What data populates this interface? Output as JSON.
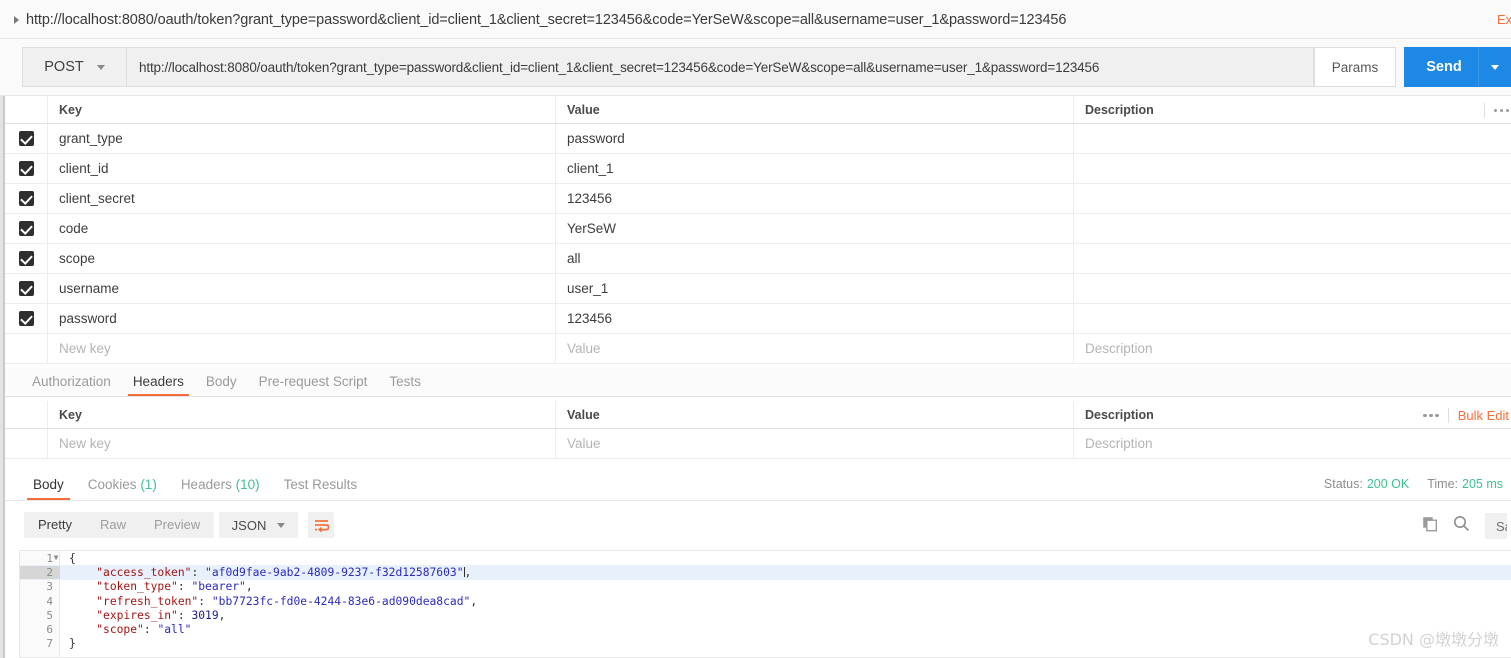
{
  "titlebar": {
    "url": "http://localhost:8080/oauth/token?grant_type=password&client_id=client_1&client_secret=123456&code=YerSeW&scope=all&username=user_1&password=123456",
    "examples_label": "Examples"
  },
  "request": {
    "method": "POST",
    "url_value": "http://localhost:8080/oauth/token?grant_type=password&client_id=client_1&client_secret=123456&code=YerSeW&scope=all&username=user_1&password=123456",
    "params_button": "Params",
    "send_button": "Send"
  },
  "params_table": {
    "headers": {
      "key": "Key",
      "value": "Value",
      "description": "Description"
    },
    "rows": [
      {
        "checked": true,
        "key": "grant_type",
        "value": "password",
        "description": ""
      },
      {
        "checked": true,
        "key": "client_id",
        "value": "client_1",
        "description": ""
      },
      {
        "checked": true,
        "key": "client_secret",
        "value": "123456",
        "description": ""
      },
      {
        "checked": true,
        "key": "code",
        "value": "YerSeW",
        "description": ""
      },
      {
        "checked": true,
        "key": "scope",
        "value": "all",
        "description": ""
      },
      {
        "checked": true,
        "key": "username",
        "value": "user_1",
        "description": ""
      },
      {
        "checked": true,
        "key": "password",
        "value": "123456",
        "description": ""
      }
    ],
    "new_row": {
      "key_placeholder": "New key",
      "value_placeholder": "Value",
      "description_placeholder": "Description"
    }
  },
  "request_tabs": [
    {
      "label": "Authorization",
      "active": false
    },
    {
      "label": "Headers",
      "active": true
    },
    {
      "label": "Body",
      "active": false
    },
    {
      "label": "Pre-request Script",
      "active": false
    },
    {
      "label": "Tests",
      "active": false
    }
  ],
  "headers_table": {
    "headers": {
      "key": "Key",
      "value": "Value",
      "description": "Description"
    },
    "bulk_edit_label": "Bulk Edit",
    "new_row": {
      "key_placeholder": "New key",
      "value_placeholder": "Value",
      "description_placeholder": "Description"
    }
  },
  "response": {
    "tabs": [
      {
        "label": "Body",
        "count": "",
        "active": true
      },
      {
        "label": "Cookies",
        "count": "(1)",
        "active": false
      },
      {
        "label": "Headers",
        "count": "(10)",
        "active": false
      },
      {
        "label": "Test Results",
        "count": "",
        "active": false
      }
    ],
    "status_label": "Status:",
    "status_value": "200 OK",
    "time_label": "Time:",
    "time_value": "205 ms",
    "view_modes": [
      {
        "label": "Pretty",
        "active": true
      },
      {
        "label": "Raw",
        "active": false
      },
      {
        "label": "Preview",
        "active": false
      }
    ],
    "format": "JSON",
    "save_response_label": "Save Response",
    "body_lines": [
      {
        "num": "1",
        "fold": true,
        "highlight": false,
        "segments": [
          {
            "t": "{",
            "c": "jp"
          }
        ]
      },
      {
        "num": "2",
        "fold": false,
        "highlight": true,
        "segments": [
          {
            "t": "    ",
            "c": "jp"
          },
          {
            "t": "\"access_token\"",
            "c": "jk"
          },
          {
            "t": ": ",
            "c": "jp"
          },
          {
            "t": "\"af0d9fae-9ab2-4809-9237-f32d12587603\"",
            "c": "js"
          },
          {
            "t": ",",
            "c": "jp"
          }
        ]
      },
      {
        "num": "3",
        "fold": false,
        "highlight": false,
        "segments": [
          {
            "t": "    ",
            "c": "jp"
          },
          {
            "t": "\"token_type\"",
            "c": "jk"
          },
          {
            "t": ": ",
            "c": "jp"
          },
          {
            "t": "\"bearer\"",
            "c": "js"
          },
          {
            "t": ",",
            "c": "jp"
          }
        ]
      },
      {
        "num": "4",
        "fold": false,
        "highlight": false,
        "segments": [
          {
            "t": "    ",
            "c": "jp"
          },
          {
            "t": "\"refresh_token\"",
            "c": "jk"
          },
          {
            "t": ": ",
            "c": "jp"
          },
          {
            "t": "\"bb7723fc-fd0e-4244-83e6-ad090dea8cad\"",
            "c": "js"
          },
          {
            "t": ",",
            "c": "jp"
          }
        ]
      },
      {
        "num": "5",
        "fold": false,
        "highlight": false,
        "segments": [
          {
            "t": "    ",
            "c": "jp"
          },
          {
            "t": "\"expires_in\"",
            "c": "jk"
          },
          {
            "t": ": ",
            "c": "jp"
          },
          {
            "t": "3019",
            "c": "jn"
          },
          {
            "t": ",",
            "c": "jp"
          }
        ]
      },
      {
        "num": "6",
        "fold": false,
        "highlight": false,
        "segments": [
          {
            "t": "    ",
            "c": "jp"
          },
          {
            "t": "\"scope\"",
            "c": "jk"
          },
          {
            "t": ": ",
            "c": "jp"
          },
          {
            "t": "\"all\"",
            "c": "js"
          }
        ]
      },
      {
        "num": "7",
        "fold": false,
        "highlight": false,
        "segments": [
          {
            "t": "}",
            "c": "jp"
          }
        ]
      }
    ]
  },
  "watermark": "CSDN @墩墩分墩"
}
